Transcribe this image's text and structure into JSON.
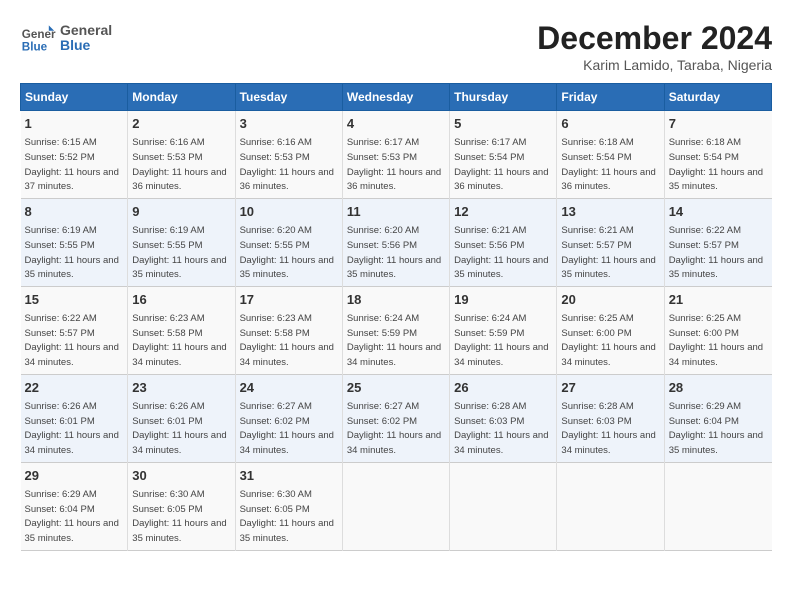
{
  "header": {
    "logo": {
      "general": "General",
      "blue": "Blue"
    },
    "title": "December 2024",
    "subtitle": "Karim Lamido, Taraba, Nigeria"
  },
  "columns": [
    "Sunday",
    "Monday",
    "Tuesday",
    "Wednesday",
    "Thursday",
    "Friday",
    "Saturday"
  ],
  "weeks": [
    [
      {
        "day": "1",
        "sunrise": "6:15 AM",
        "sunset": "5:52 PM",
        "daylight": "11 hours and 37 minutes."
      },
      {
        "day": "2",
        "sunrise": "6:16 AM",
        "sunset": "5:53 PM",
        "daylight": "11 hours and 36 minutes."
      },
      {
        "day": "3",
        "sunrise": "6:16 AM",
        "sunset": "5:53 PM",
        "daylight": "11 hours and 36 minutes."
      },
      {
        "day": "4",
        "sunrise": "6:17 AM",
        "sunset": "5:53 PM",
        "daylight": "11 hours and 36 minutes."
      },
      {
        "day": "5",
        "sunrise": "6:17 AM",
        "sunset": "5:54 PM",
        "daylight": "11 hours and 36 minutes."
      },
      {
        "day": "6",
        "sunrise": "6:18 AM",
        "sunset": "5:54 PM",
        "daylight": "11 hours and 36 minutes."
      },
      {
        "day": "7",
        "sunrise": "6:18 AM",
        "sunset": "5:54 PM",
        "daylight": "11 hours and 35 minutes."
      }
    ],
    [
      {
        "day": "8",
        "sunrise": "6:19 AM",
        "sunset": "5:55 PM",
        "daylight": "11 hours and 35 minutes."
      },
      {
        "day": "9",
        "sunrise": "6:19 AM",
        "sunset": "5:55 PM",
        "daylight": "11 hours and 35 minutes."
      },
      {
        "day": "10",
        "sunrise": "6:20 AM",
        "sunset": "5:55 PM",
        "daylight": "11 hours and 35 minutes."
      },
      {
        "day": "11",
        "sunrise": "6:20 AM",
        "sunset": "5:56 PM",
        "daylight": "11 hours and 35 minutes."
      },
      {
        "day": "12",
        "sunrise": "6:21 AM",
        "sunset": "5:56 PM",
        "daylight": "11 hours and 35 minutes."
      },
      {
        "day": "13",
        "sunrise": "6:21 AM",
        "sunset": "5:57 PM",
        "daylight": "11 hours and 35 minutes."
      },
      {
        "day": "14",
        "sunrise": "6:22 AM",
        "sunset": "5:57 PM",
        "daylight": "11 hours and 35 minutes."
      }
    ],
    [
      {
        "day": "15",
        "sunrise": "6:22 AM",
        "sunset": "5:57 PM",
        "daylight": "11 hours and 34 minutes."
      },
      {
        "day": "16",
        "sunrise": "6:23 AM",
        "sunset": "5:58 PM",
        "daylight": "11 hours and 34 minutes."
      },
      {
        "day": "17",
        "sunrise": "6:23 AM",
        "sunset": "5:58 PM",
        "daylight": "11 hours and 34 minutes."
      },
      {
        "day": "18",
        "sunrise": "6:24 AM",
        "sunset": "5:59 PM",
        "daylight": "11 hours and 34 minutes."
      },
      {
        "day": "19",
        "sunrise": "6:24 AM",
        "sunset": "5:59 PM",
        "daylight": "11 hours and 34 minutes."
      },
      {
        "day": "20",
        "sunrise": "6:25 AM",
        "sunset": "6:00 PM",
        "daylight": "11 hours and 34 minutes."
      },
      {
        "day": "21",
        "sunrise": "6:25 AM",
        "sunset": "6:00 PM",
        "daylight": "11 hours and 34 minutes."
      }
    ],
    [
      {
        "day": "22",
        "sunrise": "6:26 AM",
        "sunset": "6:01 PM",
        "daylight": "11 hours and 34 minutes."
      },
      {
        "day": "23",
        "sunrise": "6:26 AM",
        "sunset": "6:01 PM",
        "daylight": "11 hours and 34 minutes."
      },
      {
        "day": "24",
        "sunrise": "6:27 AM",
        "sunset": "6:02 PM",
        "daylight": "11 hours and 34 minutes."
      },
      {
        "day": "25",
        "sunrise": "6:27 AM",
        "sunset": "6:02 PM",
        "daylight": "11 hours and 34 minutes."
      },
      {
        "day": "26",
        "sunrise": "6:28 AM",
        "sunset": "6:03 PM",
        "daylight": "11 hours and 34 minutes."
      },
      {
        "day": "27",
        "sunrise": "6:28 AM",
        "sunset": "6:03 PM",
        "daylight": "11 hours and 34 minutes."
      },
      {
        "day": "28",
        "sunrise": "6:29 AM",
        "sunset": "6:04 PM",
        "daylight": "11 hours and 35 minutes."
      }
    ],
    [
      {
        "day": "29",
        "sunrise": "6:29 AM",
        "sunset": "6:04 PM",
        "daylight": "11 hours and 35 minutes."
      },
      {
        "day": "30",
        "sunrise": "6:30 AM",
        "sunset": "6:05 PM",
        "daylight": "11 hours and 35 minutes."
      },
      {
        "day": "31",
        "sunrise": "6:30 AM",
        "sunset": "6:05 PM",
        "daylight": "11 hours and 35 minutes."
      },
      null,
      null,
      null,
      null
    ]
  ]
}
